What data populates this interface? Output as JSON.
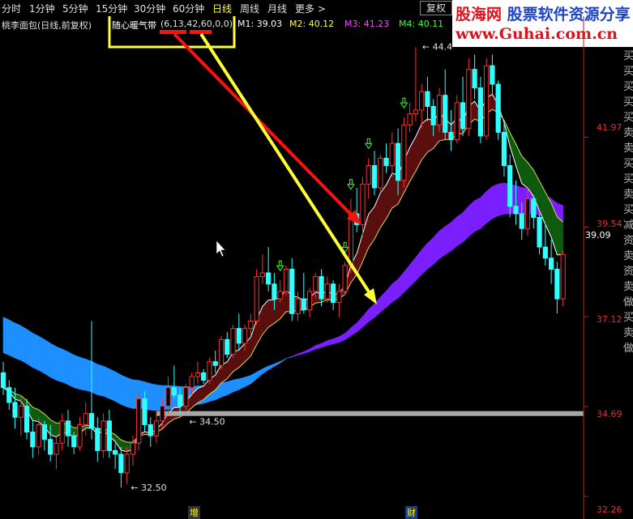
{
  "toolbar": {
    "tabs": [
      "分时",
      "1分钟",
      "5分钟",
      "15分钟",
      "30分钟",
      "60分钟",
      "日线",
      "周线",
      "月线",
      "更多 >"
    ],
    "active_tab": "日线",
    "fuquan_button": "复权"
  },
  "header": {
    "stock_name": "桃李面包(日线,前复权)",
    "indicator_name": "随心暖气带",
    "indicator_params": "(6,13,42,60,0,0)",
    "m1": "M1: 39.03",
    "m2": "M2: 40.12",
    "m3": "M3: 41.23",
    "m4": "M4: 40.11"
  },
  "watermark": {
    "line1_a": "股海网",
    "line1_b": "股票软件资源分享",
    "line2": "www.Guhai.com.cn"
  },
  "colors": {
    "up": "#ff3030",
    "down": "#30ffff",
    "band_fast_up": "#5a0e0e",
    "band_slow_up": "#7b1fff",
    "band_slow_down": "#1e8fff",
    "band_green": "#0f5a0f",
    "price_line": "#a0a0a0",
    "annotation_red": "#ff1010",
    "annotation_yellow": "#ffff33"
  },
  "right_axis": [
    "41.97",
    "39.54",
    "39.09",
    "37.12",
    "34.69",
    "32.26"
  ],
  "right_side_text": "买买买买买卖卖买买卖买减资卖资卖做买卖做",
  "bottom_markers": [
    "增",
    "财"
  ],
  "chart_data": {
    "type": "candlestick",
    "ylim": [
      32.0,
      44.8
    ],
    "price_labels": [
      {
        "text": "44.4",
        "value": 44.4
      },
      {
        "text": "34.50",
        "value": 34.5
      },
      {
        "text": "32.50",
        "value": 32.5
      }
    ],
    "horizontal_line": 34.5,
    "buy_signal_bars": [
      47,
      58,
      59,
      62,
      68
    ],
    "candles": [
      [
        35.6,
        35.9,
        35.0,
        35.2
      ],
      [
        35.2,
        35.4,
        34.6,
        34.8
      ],
      [
        34.8,
        35.2,
        34.1,
        34.4
      ],
      [
        34.4,
        35.0,
        33.9,
        34.7
      ],
      [
        34.7,
        34.9,
        33.8,
        34.0
      ],
      [
        34.0,
        34.3,
        33.3,
        33.6
      ],
      [
        33.6,
        34.4,
        33.4,
        34.2
      ],
      [
        34.2,
        34.3,
        33.5,
        33.8
      ],
      [
        33.8,
        34.2,
        33.2,
        33.4
      ],
      [
        33.4,
        33.9,
        33.0,
        33.7
      ],
      [
        33.7,
        34.5,
        33.5,
        34.3
      ],
      [
        34.3,
        34.6,
        33.6,
        33.9
      ],
      [
        33.9,
        34.0,
        33.4,
        33.6
      ],
      [
        33.6,
        34.4,
        33.5,
        34.2
      ],
      [
        34.2,
        34.8,
        33.9,
        34.5
      ],
      [
        34.5,
        37.0,
        33.8,
        34.1
      ],
      [
        34.1,
        34.4,
        33.2,
        33.5
      ],
      [
        33.5,
        34.5,
        33.3,
        34.3
      ],
      [
        34.3,
        34.6,
        33.3,
        33.5
      ],
      [
        33.5,
        33.7,
        33.0,
        33.4
      ],
      [
        33.4,
        33.6,
        32.5,
        32.9
      ],
      [
        32.9,
        33.6,
        32.6,
        33.4
      ],
      [
        33.4,
        33.9,
        33.1,
        33.7
      ],
      [
        33.7,
        35.1,
        33.5,
        34.9
      ],
      [
        34.9,
        35.1,
        34.0,
        34.2
      ],
      [
        34.2,
        34.4,
        33.6,
        33.9
      ],
      [
        33.9,
        34.6,
        33.7,
        34.3
      ],
      [
        34.3,
        34.9,
        34.1,
        34.7
      ],
      [
        34.7,
        35.5,
        34.5,
        35.2
      ],
      [
        35.2,
        35.8,
        34.9,
        35.0
      ],
      [
        35.0,
        35.2,
        34.5,
        34.7
      ],
      [
        34.7,
        35.3,
        34.6,
        35.2
      ],
      [
        35.2,
        35.6,
        35.0,
        35.5
      ],
      [
        35.5,
        35.9,
        35.3,
        35.6
      ],
      [
        35.6,
        35.7,
        35.3,
        35.4
      ],
      [
        35.4,
        36.0,
        35.3,
        35.9
      ],
      [
        35.9,
        36.2,
        35.6,
        35.8
      ],
      [
        35.8,
        36.6,
        35.7,
        36.5
      ],
      [
        36.5,
        36.7,
        36.0,
        36.1
      ],
      [
        36.1,
        36.9,
        36.0,
        36.8
      ],
      [
        36.8,
        37.2,
        36.2,
        36.4
      ],
      [
        36.4,
        36.9,
        36.2,
        36.8
      ],
      [
        36.8,
        37.2,
        36.6,
        37.0
      ],
      [
        37.0,
        38.4,
        36.9,
        38.2
      ],
      [
        38.2,
        38.8,
        38.0,
        38.3
      ],
      [
        38.3,
        39.0,
        37.8,
        38.0
      ],
      [
        38.0,
        38.3,
        37.3,
        37.6
      ],
      [
        37.6,
        38.1,
        37.5,
        37.8
      ],
      [
        37.8,
        38.5,
        37.7,
        38.4
      ],
      [
        38.4,
        38.7,
        37.0,
        37.2
      ],
      [
        37.2,
        37.8,
        37.0,
        37.6
      ],
      [
        37.6,
        38.3,
        37.2,
        37.3
      ],
      [
        37.3,
        37.9,
        37.1,
        37.8
      ],
      [
        37.8,
        38.3,
        37.6,
        38.2
      ],
      [
        38.2,
        38.4,
        37.4,
        37.6
      ],
      [
        37.6,
        38.2,
        37.5,
        38.0
      ],
      [
        38.0,
        38.1,
        37.3,
        37.5
      ],
      [
        37.5,
        38.0,
        37.1,
        37.8
      ],
      [
        37.8,
        38.6,
        37.7,
        38.5
      ],
      [
        38.5,
        40.3,
        38.3,
        39.9
      ],
      [
        39.9,
        40.6,
        39.4,
        39.6
      ],
      [
        39.6,
        40.9,
        39.3,
        40.7
      ],
      [
        40.7,
        41.4,
        40.3,
        41.2
      ],
      [
        41.2,
        41.6,
        40.4,
        40.6
      ],
      [
        40.6,
        41.5,
        40.5,
        41.4
      ],
      [
        41.4,
        41.8,
        41.0,
        41.2
      ],
      [
        41.2,
        42.1,
        40.9,
        41.8
      ],
      [
        41.8,
        42.2,
        40.4,
        40.8
      ],
      [
        40.8,
        42.5,
        40.6,
        42.3
      ],
      [
        42.3,
        42.9,
        42.1,
        42.6
      ],
      [
        42.6,
        44.4,
        42.4,
        42.7
      ],
      [
        42.7,
        43.4,
        42.2,
        43.2
      ],
      [
        43.2,
        43.6,
        42.4,
        42.8
      ],
      [
        42.8,
        43.0,
        42.0,
        42.3
      ],
      [
        42.3,
        43.3,
        42.1,
        43.1
      ],
      [
        43.1,
        43.8,
        41.9,
        42.1
      ],
      [
        42.1,
        42.7,
        41.6,
        41.9
      ],
      [
        41.9,
        43.1,
        41.8,
        42.9
      ],
      [
        42.9,
        43.6,
        42.0,
        42.2
      ],
      [
        42.2,
        44.1,
        42.0,
        43.8
      ],
      [
        43.8,
        44.2,
        43.0,
        43.3
      ],
      [
        43.3,
        43.6,
        41.8,
        42.0
      ],
      [
        42.0,
        44.1,
        41.9,
        43.9
      ],
      [
        43.9,
        44.2,
        43.1,
        43.4
      ],
      [
        43.4,
        43.5,
        41.9,
        42.1
      ],
      [
        42.1,
        42.4,
        40.9,
        41.2
      ],
      [
        41.2,
        41.5,
        39.8,
        40.1
      ],
      [
        40.1,
        40.8,
        39.6,
        39.9
      ],
      [
        39.9,
        40.2,
        39.2,
        39.5
      ],
      [
        39.5,
        40.6,
        39.3,
        40.3
      ],
      [
        40.3,
        40.4,
        39.5,
        39.8
      ],
      [
        39.8,
        39.9,
        38.8,
        39.0
      ],
      [
        39.0,
        39.6,
        38.5,
        38.7
      ],
      [
        38.7,
        39.2,
        38.0,
        38.4
      ],
      [
        38.4,
        38.6,
        37.2,
        37.6
      ],
      [
        37.6,
        38.9,
        37.4,
        38.8
      ]
    ]
  }
}
